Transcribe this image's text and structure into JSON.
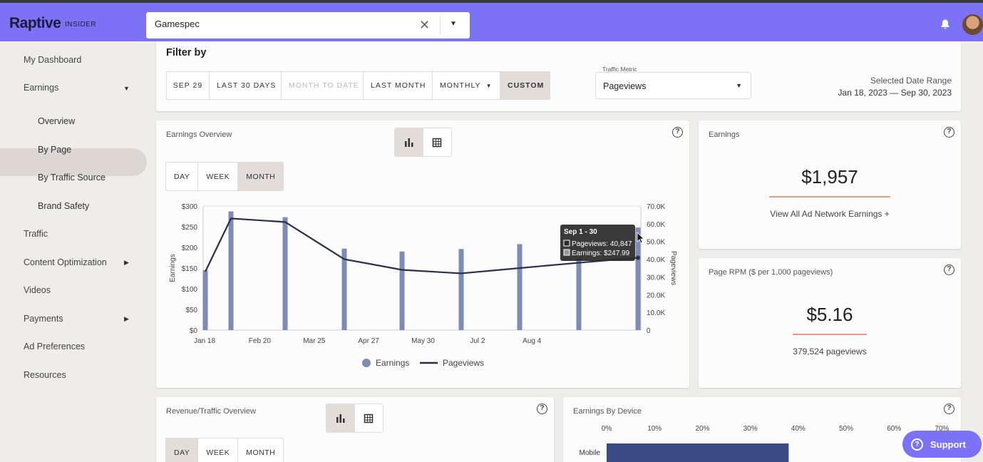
{
  "app": {
    "logo": "Raptive",
    "logo_sub": "INSIDER",
    "site_search": "Gamespec"
  },
  "sidebar": {
    "items": [
      {
        "label": "My Dashboard"
      },
      {
        "label": "Earnings"
      },
      {
        "label": "Overview"
      },
      {
        "label": "By Page"
      },
      {
        "label": "By Traffic Source"
      },
      {
        "label": "Brand Safety"
      },
      {
        "label": "Traffic"
      },
      {
        "label": "Content Optimization"
      },
      {
        "label": "Videos"
      },
      {
        "label": "Payments"
      },
      {
        "label": "Ad Preferences"
      },
      {
        "label": "Resources"
      }
    ]
  },
  "filter": {
    "title": "Filter by",
    "buttons": [
      {
        "label": "SEP 29",
        "state": "normal"
      },
      {
        "label": "LAST 30 DAYS",
        "state": "normal"
      },
      {
        "label": "MONTH TO DATE",
        "state": "disabled"
      },
      {
        "label": "LAST MONTH",
        "state": "normal"
      },
      {
        "label": "MONTHLY",
        "state": "normal"
      },
      {
        "label": "CUSTOM",
        "state": "active"
      }
    ],
    "metric_label": "Traffic Metric",
    "metric_value": "Pageviews",
    "date_range_label": "Selected Date Range",
    "date_range": "Jan 18, 2023 — Sep 30, 2023"
  },
  "overview": {
    "title": "Earnings Overview",
    "periods": [
      "DAY",
      "WEEK",
      "MONTH"
    ],
    "active_period": "MONTH",
    "legend_earnings": "Earnings",
    "legend_pageviews": "Pageviews",
    "tooltip": {
      "title": "Sep 1 - 30",
      "pageviews": "Pageviews: 40,847",
      "earnings": "Earnings: $247.99"
    }
  },
  "chart_data": {
    "type": "bar",
    "categories": [
      "Jan 18",
      "Feb",
      "Mar",
      "Apr",
      "May",
      "Jun",
      "Jul",
      "Aug",
      "Sep"
    ],
    "x_tick_labels": [
      "Jan 18",
      "Feb 20",
      "Mar 25",
      "Apr 27",
      "May 30",
      "Jul 2",
      "Aug 4"
    ],
    "series": [
      {
        "name": "Earnings",
        "type": "bar",
        "axis": "left",
        "values": [
          145,
          287,
          273,
          197,
          190,
          196,
          208,
          175,
          247.99
        ]
      },
      {
        "name": "Pageviews",
        "type": "line",
        "axis": "right",
        "values": [
          33000,
          63000,
          61000,
          40000,
          34000,
          32000,
          35000,
          38000,
          40847
        ]
      }
    ],
    "ylabel": "Earnings",
    "y2label": "Pageviews",
    "ylim": [
      0,
      300
    ],
    "y_ticks": [
      "$0",
      "$50",
      "$100",
      "$150",
      "$200",
      "$250",
      "$300"
    ],
    "y2lim": [
      0,
      70000
    ],
    "y2_ticks": [
      "0",
      "10.0K",
      "20.0K",
      "30.0K",
      "40.0K",
      "50.0K",
      "60.0K",
      "70.0K"
    ],
    "legend": "bottom",
    "colors": {
      "bars": "#7d8bb5",
      "line": "#2a2f4a"
    }
  },
  "earnings_card": {
    "title": "Earnings",
    "value": "$1,957",
    "link": "View All Ad Network Earnings +"
  },
  "rpm_card": {
    "title": "Page RPM ($ per 1,000 pageviews)",
    "value": "$5.16",
    "sub": "379,524 pageviews"
  },
  "revenue_card": {
    "title": "Revenue/Traffic Overview",
    "periods": [
      "DAY",
      "WEEK",
      "MONTH"
    ]
  },
  "device_card": {
    "title": "Earnings By Device",
    "ticks": [
      "0%",
      "10%",
      "20%",
      "30%",
      "40%",
      "50%",
      "60%",
      "70%"
    ],
    "rows": [
      {
        "label": "Mobile",
        "value": 38
      }
    ]
  },
  "support": {
    "label": "Support"
  },
  "colors": {
    "brand": "#7b72f6",
    "accent_line": "#e99a86",
    "active_bg": "#e2ddd8"
  }
}
